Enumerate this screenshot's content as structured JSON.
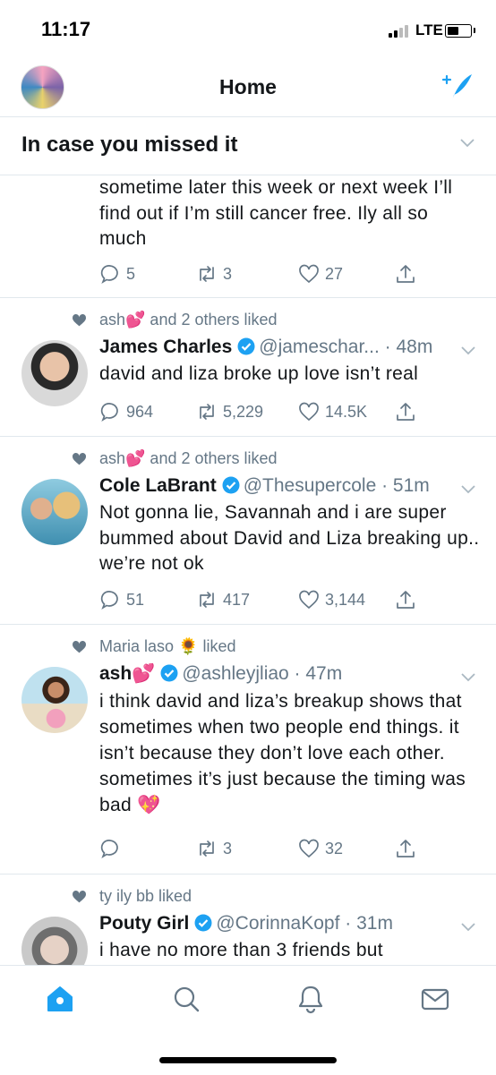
{
  "status_bar": {
    "time": "11:17",
    "network": "LTE"
  },
  "header": {
    "title": "Home"
  },
  "section": {
    "title": "In case you missed it"
  },
  "partial_tweet": {
    "text": "sometime later this week or next week I’ll find out if I’m still cancer free. Ily all so much",
    "replies": "5",
    "retweets": "3",
    "likes": "27"
  },
  "tweets": [
    {
      "liked_by": "ash💕 and 2 others liked",
      "name": "James Charles",
      "meta": "@jameschar... · 48m",
      "text": "david and liza broke up love isn’t real",
      "replies": "964",
      "retweets": "5,229",
      "likes": "14.5K"
    },
    {
      "liked_by": "ash💕 and 2 others liked",
      "name": "Cole LaBrant",
      "meta": "@Thesupercole · 51m",
      "text": "Not gonna lie, Savannah and i are super bummed about David and Liza breaking up.. we’re not ok",
      "replies": "51",
      "retweets": "417",
      "likes": "3,144"
    },
    {
      "liked_by": "Maria laso 🌻 liked",
      "name": "ash💕",
      "meta": "@ashleyjliao · 47m",
      "text": "i think david and liza’s breakup shows that sometimes when two people end things. it isn’t because they don’t love each other. sometimes it’s just because the timing was bad 💖",
      "replies": "",
      "retweets": "3",
      "likes": "32"
    },
    {
      "liked_by": "ty ily bb liked",
      "name": "Pouty Girl",
      "meta": "@CorinnaKopf · 31m",
      "text": "i have no more than 3 friends but"
    }
  ],
  "colors": {
    "accent": "#1da1f2",
    "secondary_text": "#657786",
    "divider": "#e1e8ed"
  },
  "icons": [
    "compose-icon",
    "chevron-down-icon",
    "reply-icon",
    "retweet-icon",
    "like-icon",
    "share-icon",
    "verified-icon",
    "home-icon",
    "search-icon",
    "notifications-icon",
    "messages-icon"
  ]
}
